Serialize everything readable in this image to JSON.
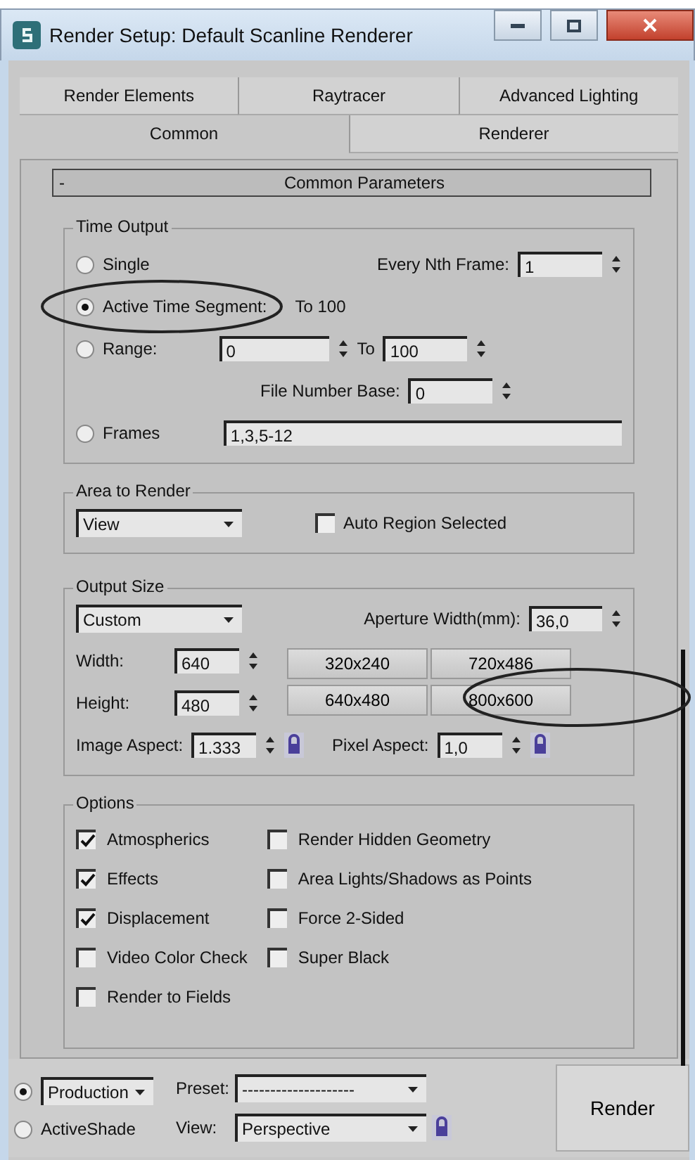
{
  "window": {
    "title": "Render Setup: Default Scanline Renderer"
  },
  "tab_rows": [
    [
      {
        "label": "Render Elements",
        "selected": false
      },
      {
        "label": "Raytracer",
        "selected": false
      },
      {
        "label": "Advanced Lighting",
        "selected": false
      }
    ],
    [
      {
        "label": "Common",
        "selected": true
      },
      {
        "label": "Renderer",
        "selected": false
      }
    ]
  ],
  "rollout": {
    "sign": "-",
    "title": "Common Parameters"
  },
  "time_output": {
    "title": "Time Output",
    "options": [
      {
        "label": "Single",
        "selected": false
      },
      {
        "label": "Active Time Segment:",
        "selected": true
      },
      {
        "label": "Range:",
        "selected": false
      },
      {
        "label": "Frames",
        "selected": false
      }
    ],
    "every_nth_frame": {
      "label": "Every Nth Frame:",
      "value": "1"
    },
    "active_segment_range": "To 100",
    "range_from": "0",
    "range_to_label": "To",
    "range_to": "100",
    "file_number_base": {
      "label": "File Number Base:",
      "value": "0"
    },
    "frames": "1,3,5-12"
  },
  "area_to_render": {
    "title": "Area to Render",
    "dropdown": "View",
    "auto_region": {
      "label": "Auto Region Selected",
      "checked": false
    }
  },
  "output_size": {
    "title": "Output Size",
    "dropdown": "Custom",
    "aperture": {
      "label": "Aperture Width(mm):",
      "value": "36,0"
    },
    "width": {
      "label": "Width:",
      "value": "640"
    },
    "height": {
      "label": "Height:",
      "value": "480"
    },
    "presets": [
      "320x240",
      "720x486",
      "640x480",
      "800x600"
    ],
    "image_aspect": {
      "label": "Image Aspect:",
      "value": "1.333"
    },
    "pixel_aspect": {
      "label": "Pixel Aspect:",
      "value": "1,0"
    }
  },
  "options": {
    "title": "Options",
    "columns": [
      [
        {
          "label": "Atmospherics",
          "checked": true
        },
        {
          "label": "Effects",
          "checked": true
        },
        {
          "label": "Displacement",
          "checked": true
        },
        {
          "label": "Video Color Check",
          "checked": false
        },
        {
          "label": "Render to Fields",
          "checked": false
        }
      ],
      [
        {
          "label": "Render Hidden Geometry",
          "checked": false
        },
        {
          "label": "Area Lights/Shadows as Points",
          "checked": false
        },
        {
          "label": "Force 2-Sided",
          "checked": false
        },
        {
          "label": "Super Black",
          "checked": false
        }
      ]
    ]
  },
  "bottom": {
    "modes": [
      {
        "label": "Production",
        "kind": "dropdown",
        "selected": true
      },
      {
        "label": "ActiveShade",
        "kind": "text",
        "selected": false
      }
    ],
    "preset": {
      "label": "Preset:",
      "value": "--------------------"
    },
    "view": {
      "label": "View:",
      "value": "Perspective"
    },
    "render_button": "Render"
  }
}
